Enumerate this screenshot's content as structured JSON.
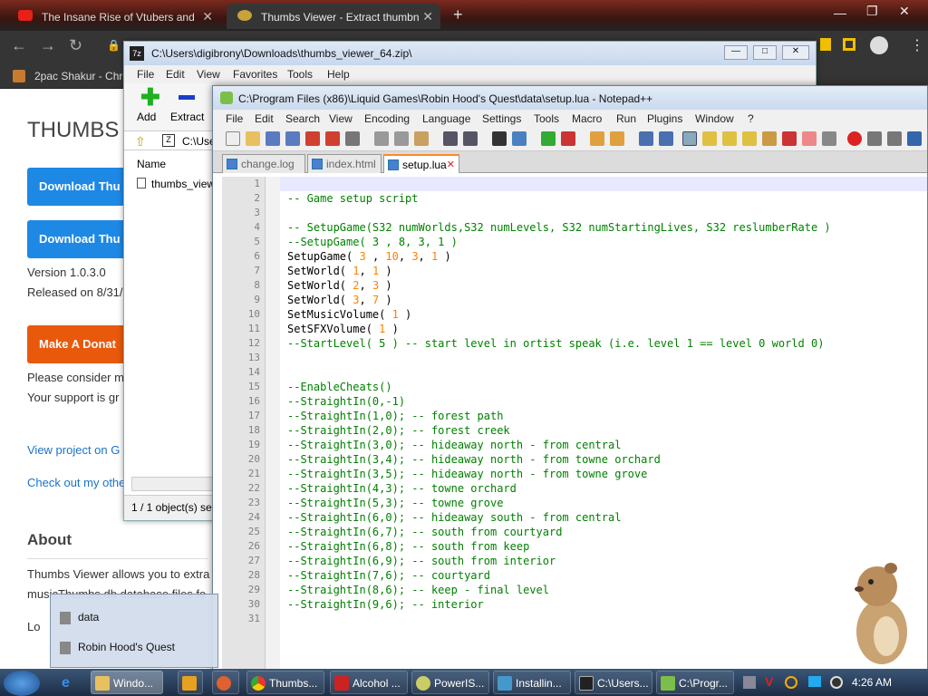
{
  "chrome": {
    "tabs": [
      {
        "label": "The Insane Rise of Vtubers and",
        "active": false
      },
      {
        "label": "Thumbs Viewer - Extract thumbn",
        "active": true
      }
    ],
    "new_tab": "+",
    "bookmark": "2pac Shakur - Chro"
  },
  "webpage": {
    "title": "THUMBS",
    "download1": "Download Thu",
    "download2": "Download Thu",
    "version": "Version 1.0.3.0",
    "released": "Released on 8/31/",
    "donate": "Make A Donat",
    "consider": "Please consider m",
    "support": "Your support is gr",
    "view_project": "View project on G",
    "check_out": "Check out my othe",
    "about_heading": "About",
    "about_text": "Thumbs Viewer allows you to extra",
    "about_text2": "musicThumbs.db database files fo",
    "lo": "Lo"
  },
  "zip": {
    "title": "C:\\Users\\digibrony\\Downloads\\thumbs_viewer_64.zip\\",
    "menu": [
      "File",
      "Edit",
      "View",
      "Favorites",
      "Tools",
      "Help"
    ],
    "add": "Add",
    "extract": "Extract",
    "path": "C:\\Use",
    "col_name": "Name",
    "file": "thumbs_view",
    "status": "1 / 1 object(s) sel"
  },
  "npp": {
    "title": "C:\\Program Files (x86)\\Liquid Games\\Robin Hood's Quest\\data\\setup.lua - Notepad++",
    "menu": [
      "File",
      "Edit",
      "Search",
      "View",
      "Encoding",
      "Language",
      "Settings",
      "Tools",
      "Macro",
      "Run",
      "Plugins",
      "Window",
      "?"
    ],
    "tabs": [
      {
        "label": "change.log",
        "active": false
      },
      {
        "label": "index.html",
        "active": false
      },
      {
        "label": "setup.lua",
        "active": true
      }
    ],
    "lines": [
      "",
      "-- Game setup script",
      "",
      "-- SetupGame(S32 numWorlds,S32 numLevels, S32 numStartingLives, S32 reslumberRate )",
      "--SetupGame( 3 , 8, 3, 1 )",
      "SetupGame( 3 , 10, 3, 1 )",
      "SetWorld( 1, 1 )",
      "SetWorld( 2, 3 )",
      "SetWorld( 3, 7 )",
      "SetMusicVolume( 1 )",
      "SetSFXVolume( 1 )",
      "--StartLevel( 5 ) -- start level in ortist speak (i.e. level 1 == level 0 world 0)",
      "",
      "",
      "--EnableCheats()",
      "--StraightIn(0,-1)",
      "--StraightIn(1,0); -- forest path",
      "--StraightIn(2,0); -- forest creek",
      "--StraightIn(3,0); -- hideaway north - from central",
      "--StraightIn(3,4); -- hideaway north - from towne orchard",
      "--StraightIn(3,5); -- hideaway north - from towne grove",
      "--StraightIn(4,3); -- towne orchard",
      "--StraightIn(5,3); -- towne grove",
      "--StraightIn(6,0); -- hideaway south - from central",
      "--StraightIn(6,7); -- south from courtyard",
      "--StraightIn(6,8); -- south from keep",
      "--StraightIn(6,9); -- south from interior",
      "--StraightIn(7,6); -- courtyard",
      "--StraightIn(8,6); -- keep - final level",
      "--StraightIn(9,6); -- interior",
      ""
    ],
    "line_numbers": [
      "1",
      "2",
      "3",
      "4",
      "5",
      "6",
      "7",
      "8",
      "9",
      "10",
      "11",
      "12",
      "13",
      "14",
      "15",
      "16",
      "17",
      "18",
      "19",
      "20",
      "21",
      "22",
      "23",
      "24",
      "25",
      "26",
      "27",
      "28",
      "29",
      "30",
      "31"
    ]
  },
  "jumplist": {
    "items": [
      "data",
      "Robin Hood's Quest"
    ]
  },
  "taskbar": {
    "items": [
      "Windo...",
      "",
      "",
      "Thumbs...",
      "Alcohol ...",
      "PowerIS...",
      "Installin...",
      "C:\\Users...",
      "C:\\Progr..."
    ],
    "clock": "4:26 AM"
  },
  "colors": {
    "comment": "#008000",
    "number": "#ff8000",
    "accent_tab": "#fa8b2a",
    "button_blue": "#1e88e5",
    "button_orange": "#e8590c"
  }
}
